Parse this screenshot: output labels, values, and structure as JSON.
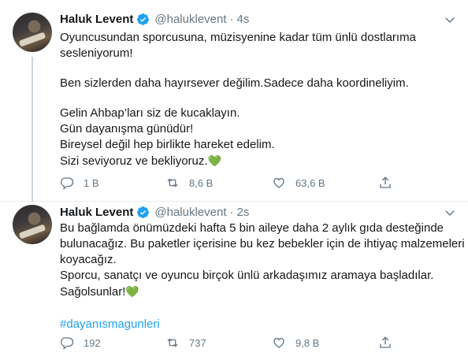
{
  "tweets": [
    {
      "name": "Haluk Levent",
      "handle": "@haluklevent",
      "separator": "·",
      "time": "4s",
      "lines": [
        "Oyuncusundan sporcusuna, müzisyenine kadar tüm ünlü dostlarıma",
        "sesleniyorum!",
        "",
        "Ben sizlerden daha hayırsever değilim.Sadece daha koordineliyim.",
        "",
        "Gelin Ahbap’ları siz de kucaklayın.",
        "Gün dayanışma günüdür!",
        "Bireysel değil hep birlikte hareket edelim.",
        "Sizi seviyoruz ve bekliyoruz."
      ],
      "emoji": "💚",
      "replies": "1 B",
      "retweets": "8,6 B",
      "likes": "63,6 B"
    },
    {
      "name": "Haluk Levent",
      "handle": "@haluklevent",
      "separator": "·",
      "time": "2s",
      "lines": [
        "Bu bağlamda önümüzdeki hafta 5 bin aileye daha 2 aylık gıda desteğinde",
        "bulunacağız. Bu paketler içerisine bu kez bebekler için de ihtiyaç malzemeleri",
        "koyacağız.",
        "Sporcu, sanatçı ve oyuncu birçok ünlü arkadaşımız aramaya başladılar.",
        "Sağolsunlar!"
      ],
      "emoji": "💚",
      "hashtag": "#dayanısmagunleri",
      "replies": "192",
      "retweets": "737",
      "likes": "9,8 B"
    }
  ],
  "icons": {
    "verified": "verified-badge-icon",
    "caret": "chevron-down-icon",
    "reply": "reply-icon",
    "retweet": "retweet-icon",
    "like": "heart-icon",
    "share": "share-icon"
  },
  "colors": {
    "accent": "#1da1f2",
    "muted": "#657786",
    "text": "#14171a",
    "green_heart": "#77b255"
  }
}
